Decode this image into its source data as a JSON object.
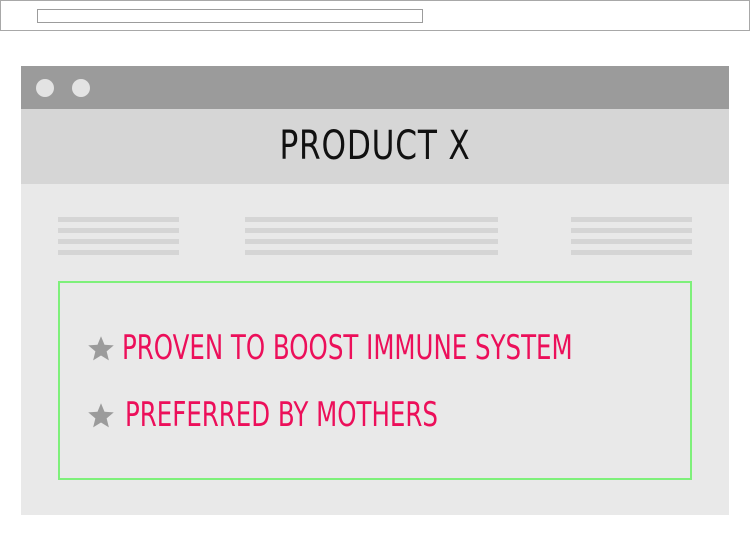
{
  "product": {
    "title": "PRODUCT X"
  },
  "benefits": [
    {
      "icon": "star-icon",
      "text": "PROVEN TO BOOST IMMUNE SYSTEM"
    },
    {
      "icon": "star-icon",
      "text": "PREFERRED BY MOTHERS"
    }
  ],
  "colors": {
    "benefit_text": "#ec0f5a",
    "box_border": "#7ef07a",
    "title_bar": "#9b9b9b",
    "header": "#d6d6d6",
    "window_body": "#e9e9e9",
    "star": "#9b9b9b"
  }
}
